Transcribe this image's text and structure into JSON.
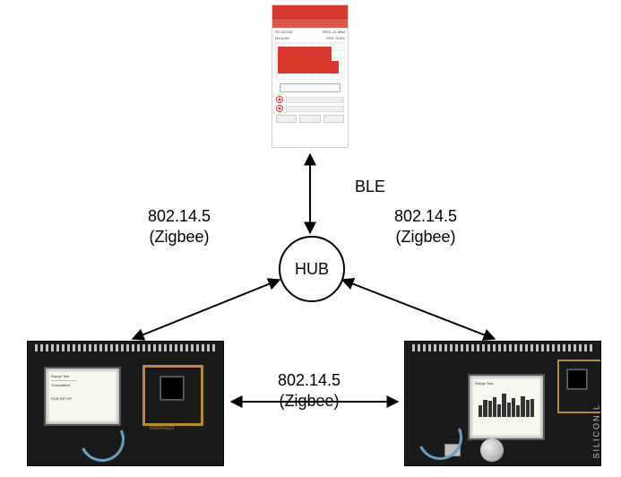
{
  "hub": {
    "label": "HUB"
  },
  "links": {
    "ble": "BLE",
    "left": "802.14.5\n(Zigbee)",
    "right": "802.14.5\n(Zigbee)",
    "bottom": "802.14.5\n(Zigbee)"
  },
  "phone": {
    "stat_top_left": "RC 42/228",
    "stat_top_right": "RSSI -11 dBM",
    "stat_bot_left": "MA 5.5%",
    "stat_bot_right": "PER 70.8%"
  },
  "boards": {
    "left_chip_label": "EFR32xG21",
    "right_brand": "SILICON L"
  }
}
